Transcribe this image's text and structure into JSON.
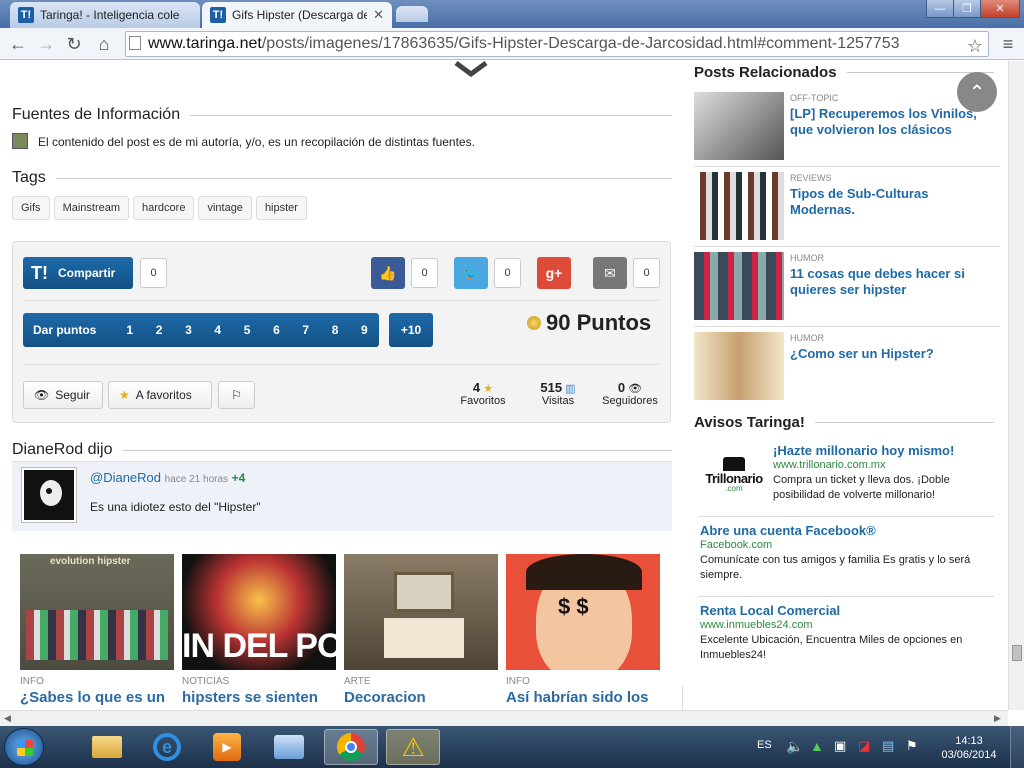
{
  "browser": {
    "tabs": [
      {
        "title": "Taringa! - Inteligencia colectiva",
        "favicon": "T!"
      },
      {
        "title": "Gifs Hipster (Descarga de",
        "favicon": "T!"
      }
    ],
    "url_domain": "www.taringa.net",
    "url_path": "/posts/imagenes/17863635/Gifs-Hipster-Descarga-de-Jarcosidad.html#comment-1257753"
  },
  "post": {
    "sources_heading": "Fuentes de Información",
    "sources_text": "El contenido del post es de mi autoría, y/o, es un recopilación de distintas fuentes.",
    "tags_heading": "Tags",
    "tags": [
      "Gifs",
      "Mainstream",
      "hardcore",
      "vintage",
      "hipster"
    ],
    "share_label": "Compartir",
    "share_count": "0",
    "like_count": "0",
    "twitter_count": "0",
    "gplus_label": "g+",
    "email_count": "0",
    "give_points_label": "Dar puntos",
    "points_options": [
      "1",
      "2",
      "3",
      "4",
      "5",
      "6",
      "7",
      "8",
      "9"
    ],
    "plus_ten": "+10",
    "points_total": "90 Puntos",
    "follow_label": "Seguir",
    "favorites_button": "A favoritos",
    "stats": [
      {
        "value": "4",
        "label": "Favoritos"
      },
      {
        "value": "515",
        "label": "Visitas"
      },
      {
        "value": "0",
        "label": "Seguidores"
      }
    ]
  },
  "comment": {
    "heading": "DianeRod dijo",
    "user": "@DianeRod",
    "time": "hace 21 horas",
    "score": "+4",
    "text": "Es una idiotez esto del \"Hipster\""
  },
  "cards": [
    {
      "category": "INFO",
      "title": "¿Sabes lo que es un",
      "image_text": "evolution hipster"
    },
    {
      "category": "NOTICIAS",
      "title": "hipsters se sienten",
      "image_text": "IN DEL POS"
    },
    {
      "category": "ARTE",
      "title": "Decoracion",
      "image_text": ""
    },
    {
      "category": "INFO",
      "title": "Así habrían sido los",
      "image_text": ""
    }
  ],
  "sidebar": {
    "related_heading": "Posts Relacionados",
    "related": [
      {
        "category": "OFF-TOPIC",
        "title": "[LP] Recuperemos los Vinilos, que volvieron los clásicos"
      },
      {
        "category": "REVIEWS",
        "title": "Tipos de Sub-Culturas Modernas."
      },
      {
        "category": "HUMOR",
        "title": "11 cosas que debes hacer si quieres ser hipster"
      },
      {
        "category": "HUMOR",
        "title": "¿Como ser un Hipster?"
      }
    ],
    "ads_heading": "Avisos Taringa!",
    "ads": [
      {
        "title": "¡Hazte millonario hoy mismo!",
        "url": "www.trillonario.com.mx",
        "desc": "Compra un ticket y lleva dos. ¡Doble posibilidad de volverte millonario!",
        "logo": "Trillonario",
        "logo_sub": ".com"
      },
      {
        "title": "Abre una cuenta Facebook®",
        "url": "Facebook.com",
        "desc": "Comunícate con tus amigos y familia Es gratis y lo será siempre."
      },
      {
        "title": "Renta Local Comercial",
        "url": "www.inmuebles24.com",
        "desc": "Excelente Ubicación, Encuentra Miles de opciones en Inmuebles24!"
      }
    ]
  },
  "taskbar": {
    "lang": "ES",
    "time": "14:13",
    "date": "03/06/2014"
  }
}
